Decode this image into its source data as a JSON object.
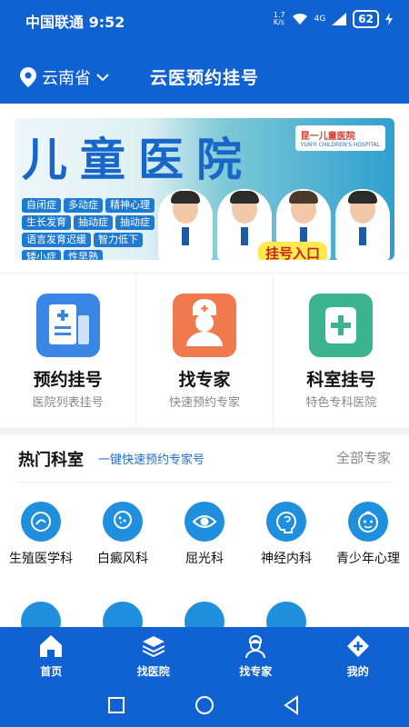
{
  "status_bar": {
    "carrier": "中国联通",
    "time": "9:52",
    "speed": "1.7\nK/s",
    "signal": "4G",
    "battery": "62"
  },
  "header": {
    "location": "云南省",
    "title": "云医预约挂号"
  },
  "banner": {
    "title": "儿童医院",
    "logo_text": "昆一儿童医院",
    "logo_sub": "YUNYI CHILDREN'S HOSPITAL",
    "tags": [
      "自闭症",
      "多动症",
      "精神心理",
      "生长发育",
      "抽动症",
      "抽动症",
      "语言发育迟缓",
      "智力低下",
      "矮小症",
      "性早熟"
    ],
    "cta": "挂号入口"
  },
  "quick_actions": [
    {
      "title": "预约挂号",
      "subtitle": "医院列表挂号",
      "icon": "hospital-list-icon",
      "color": "#3a86e4"
    },
    {
      "title": "找专家",
      "subtitle": "快速预约专家",
      "icon": "doctor-icon",
      "color": "#f0794e"
    },
    {
      "title": "科室挂号",
      "subtitle": "特色专科医院",
      "icon": "medical-cross-icon",
      "color": "#3bb38e"
    }
  ],
  "departments": {
    "title": "热门科室",
    "slogan": "一键快速预约专家号",
    "all_label": "全部专家",
    "items": [
      {
        "label": "生殖医学科",
        "icon": "reproductive-icon"
      },
      {
        "label": "白癜风科",
        "icon": "skin-icon"
      },
      {
        "label": "屈光科",
        "icon": "eye-icon"
      },
      {
        "label": "神经内科",
        "icon": "brain-icon"
      },
      {
        "label": "青少年心理",
        "icon": "child-face-icon"
      }
    ],
    "row2_icons": [
      "kidney-icon",
      "joint-icon",
      "ent-icon",
      "stomach-icon"
    ]
  },
  "bottom_nav": [
    {
      "label": "首页",
      "icon": "home-icon",
      "active": true
    },
    {
      "label": "找医院",
      "icon": "layers-icon",
      "active": false
    },
    {
      "label": "找专家",
      "icon": "doctor-nav-icon",
      "active": false
    },
    {
      "label": "我的",
      "icon": "profile-icon",
      "active": false
    }
  ],
  "colors": {
    "primary": "#1061d2",
    "accent_blue": "#1f8fde"
  }
}
